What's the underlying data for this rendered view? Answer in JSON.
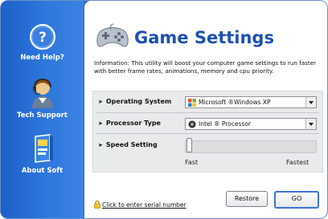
{
  "sidebar": {
    "items": [
      {
        "label": "Need Help?",
        "icon": "question-icon"
      },
      {
        "label": "Tech Support",
        "icon": "support-person-icon"
      },
      {
        "label": "About Soft",
        "icon": "software-box-icon"
      }
    ]
  },
  "header": {
    "title": "Game Settings",
    "icon": "gamepad-icon"
  },
  "info": "Information: This utility will boost your computer game settings to run faster with better frame rates, animations, memory and cpu priority.",
  "settings": {
    "os": {
      "label": "Operating System",
      "value": "Microsoft ®Windows XP",
      "icon": "windows-flag-icon"
    },
    "processor": {
      "label": "Processor Type",
      "value": "Intel ® Processor",
      "icon": "processor-icon"
    },
    "speed": {
      "label": "Speed Setting",
      "min_label": "Fast",
      "max_label": "Fastest",
      "level": 0
    }
  },
  "footer": {
    "serial_link": "Click to enter serial number",
    "restore_label": "Restore",
    "go_label": "GO"
  },
  "colors": {
    "sidebar_blue": "#2b6ccf",
    "title_blue": "#1e50b4",
    "panel_gray": "#e9eaec"
  }
}
